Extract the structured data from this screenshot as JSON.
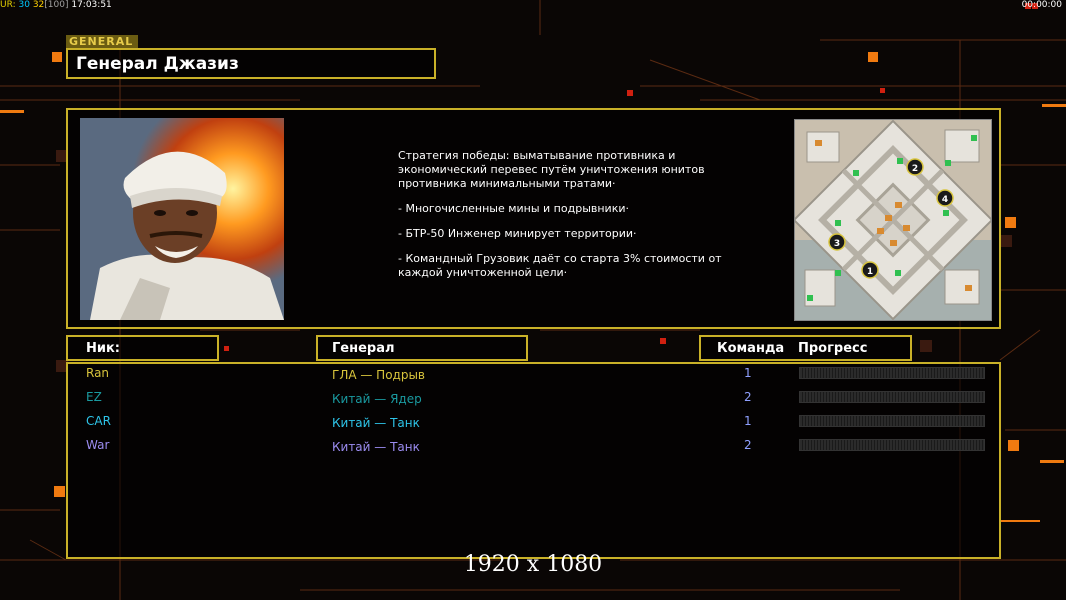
{
  "topbar": {
    "ur_label": "UR:",
    "val1": "30",
    "val2": "32",
    "bracket": "[100]",
    "time_left": "17:03:51",
    "time_right": "00:00:00"
  },
  "general_tag": "GENERAL",
  "title": "Генерал Джазиз",
  "strategy": {
    "lines": [
      "Стратегия победы: выматывание противника и экономический перевес путём уничтожения юнитов противника минимальными тратами·",
      "- Многочисленные мины и подрывники·",
      "- БТР-50 Инженер минирует территории·",
      "- Командный Грузовик даёт со старта 3% стоимости от каждой уничтоженной цели·"
    ]
  },
  "map": {
    "spawn_labels": [
      "1",
      "2",
      "3",
      "4"
    ]
  },
  "columns": {
    "nick": "Ник:",
    "general": "Генерал",
    "team": "Команда",
    "progress": "Прогресс"
  },
  "players": [
    {
      "nick": "Ran",
      "general": "ГЛА — Подрыв",
      "team": "1",
      "progress": 0,
      "nick_color": "#d8c43c",
      "general_color": "#d8c43c"
    },
    {
      "nick": "EZ",
      "general": "Китай — Ядер",
      "team": "2",
      "progress": 0,
      "nick_color": "#1a9aa0",
      "general_color": "#1a9aa0"
    },
    {
      "nick": "CAR",
      "general": "Китай — Танк",
      "team": "1",
      "progress": 0,
      "nick_color": "#2ec4e8",
      "general_color": "#2ec4e8"
    },
    {
      "nick": "War",
      "general": "Китай — Танк",
      "team": "2",
      "progress": 0,
      "nick_color": "#9b8cf0",
      "general_color": "#9b8cf0"
    }
  ],
  "colors": {
    "frame": "#c9b128",
    "accent_orange": "#f07a10",
    "team_color": "#8fa0ff"
  },
  "resolution": "1920 x 1080"
}
